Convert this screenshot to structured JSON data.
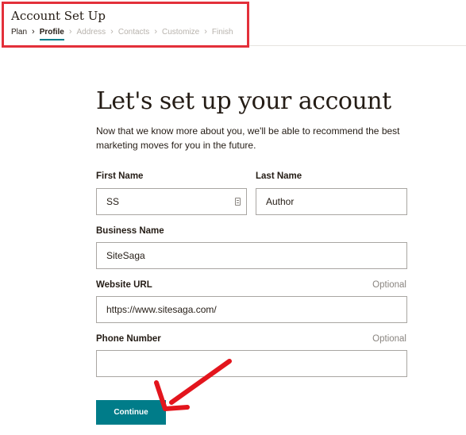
{
  "header": {
    "title": "Account Set Up",
    "steps": [
      {
        "label": "Plan",
        "state": "done"
      },
      {
        "label": "Profile",
        "state": "active"
      },
      {
        "label": "Address",
        "state": "upcoming"
      },
      {
        "label": "Contacts",
        "state": "upcoming"
      },
      {
        "label": "Customize",
        "state": "upcoming"
      },
      {
        "label": "Finish",
        "state": "upcoming"
      }
    ],
    "separator": "›"
  },
  "main": {
    "title": "Let's set up your account",
    "intro": "Now that we know more about you, we'll be able to recommend the best marketing moves for you in the future."
  },
  "form": {
    "first_name": {
      "label": "First Name",
      "value": "SS"
    },
    "last_name": {
      "label": "Last Name",
      "value": "Author"
    },
    "business_name": {
      "label": "Business Name",
      "value": "SiteSaga"
    },
    "website_url": {
      "label": "Website URL",
      "optional": "Optional",
      "value": "https://www.sitesaga.com/"
    },
    "phone_number": {
      "label": "Phone Number",
      "optional": "Optional",
      "value": ""
    },
    "continue_label": "Continue"
  },
  "colors": {
    "accent": "#007c89",
    "highlight": "#e3303a",
    "text": "#241c15",
    "muted": "#b8b3ad"
  },
  "icons": {
    "autofill": "contact-card-icon",
    "arrow": "red-arrow-annotation"
  }
}
